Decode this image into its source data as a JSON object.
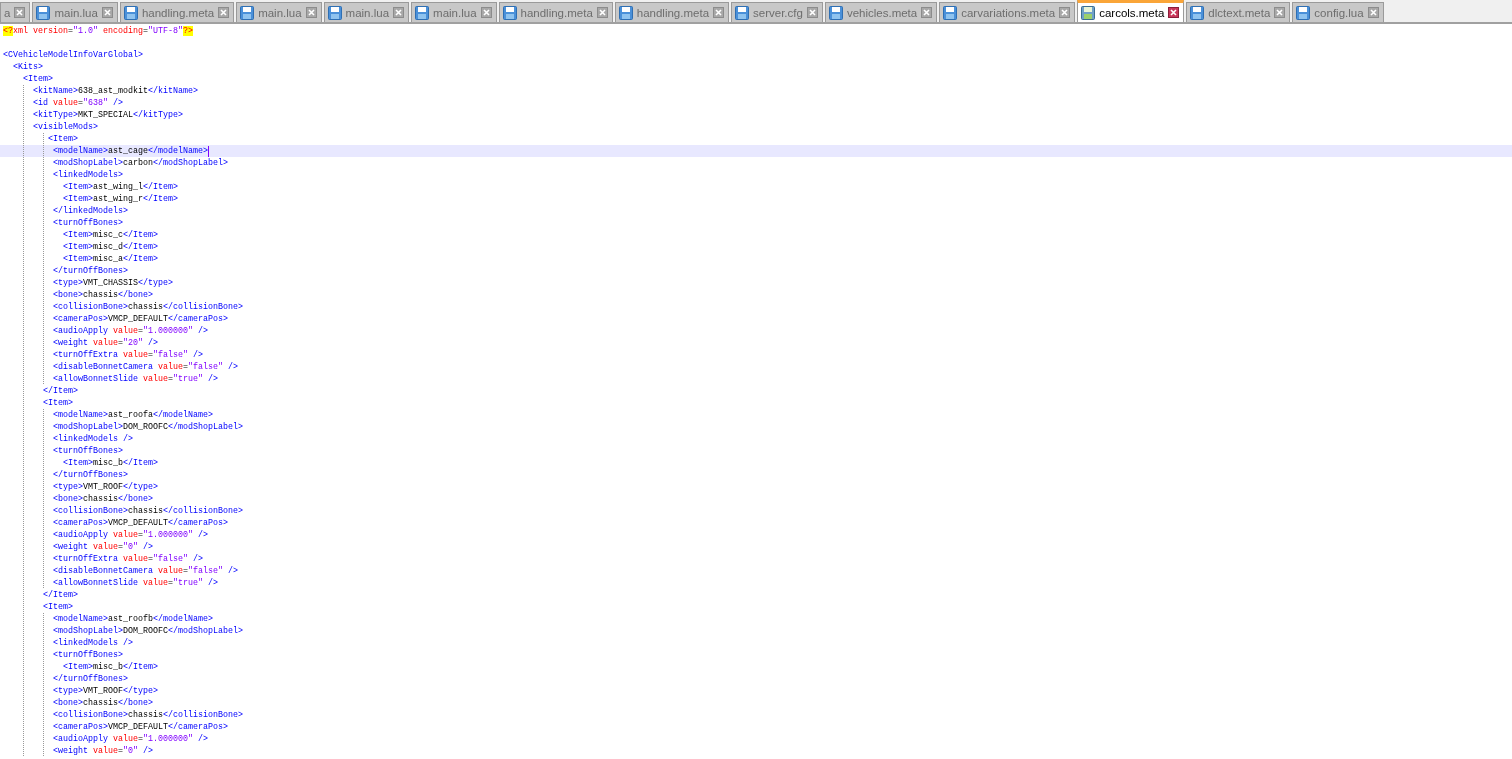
{
  "tabs": [
    {
      "label": "a",
      "selected": false
    },
    {
      "label": "main.lua",
      "selected": false
    },
    {
      "label": "handling.meta",
      "selected": false
    },
    {
      "label": "main.lua",
      "selected": false
    },
    {
      "label": "main.lua",
      "selected": false
    },
    {
      "label": "main.lua",
      "selected": false
    },
    {
      "label": "handling.meta",
      "selected": false
    },
    {
      "label": "handling.meta",
      "selected": false
    },
    {
      "label": "server.cfg",
      "selected": false
    },
    {
      "label": "vehicles.meta",
      "selected": false
    },
    {
      "label": "carvariations.meta",
      "selected": false
    },
    {
      "label": "carcols.meta",
      "selected": true
    },
    {
      "label": "dlctext.meta",
      "selected": false
    },
    {
      "label": "config.lua",
      "selected": false
    }
  ],
  "editor": {
    "lines": [
      {
        "kind": "code",
        "text": "<?xml version=\"1.0\" encoding=\"UTF-8\"?>",
        "current": false
      },
      {
        "kind": "blank",
        "current": false
      },
      {
        "kind": "code",
        "text": "<CVehicleModelInfoVarGlobal>",
        "current": false
      },
      {
        "kind": "code",
        "text": "  <Kits>",
        "current": false
      },
      {
        "kind": "code",
        "text": "    <Item>",
        "current": false
      },
      {
        "kind": "code",
        "text": "      <kitName>638_ast_modkit</kitName>",
        "current": false
      },
      {
        "kind": "code",
        "text": "      <id value=\"638\" />",
        "current": false
      },
      {
        "kind": "code",
        "text": "      <kitType>MKT_SPECIAL</kitType>",
        "current": false
      },
      {
        "kind": "code",
        "text": "      <visibleMods>",
        "current": false
      },
      {
        "kind": "code",
        "text": "         <Item>",
        "current": false
      },
      {
        "kind": "code",
        "text": "          <modelName>ast_cage</modelName>",
        "current": true
      },
      {
        "kind": "code",
        "text": "          <modShopLabel>carbon</modShopLabel>",
        "current": false
      },
      {
        "kind": "code",
        "text": "          <linkedModels>",
        "current": false
      },
      {
        "kind": "code",
        "text": "            <Item>ast_wing_l</Item>",
        "current": false
      },
      {
        "kind": "code",
        "text": "            <Item>ast_wing_r</Item>",
        "current": false
      },
      {
        "kind": "code",
        "text": "          </linkedModels>",
        "current": false
      },
      {
        "kind": "code",
        "text": "          <turnOffBones>",
        "current": false
      },
      {
        "kind": "code",
        "text": "            <Item>misc_c</Item>",
        "current": false
      },
      {
        "kind": "code",
        "text": "            <Item>misc_d</Item>",
        "current": false
      },
      {
        "kind": "code",
        "text": "            <Item>misc_a</Item>",
        "current": false
      },
      {
        "kind": "code",
        "text": "          </turnOffBones>",
        "current": false
      },
      {
        "kind": "code",
        "text": "          <type>VMT_CHASSIS</type>",
        "current": false
      },
      {
        "kind": "code",
        "text": "          <bone>chassis</bone>",
        "current": false
      },
      {
        "kind": "code",
        "text": "          <collisionBone>chassis</collisionBone>",
        "current": false
      },
      {
        "kind": "code",
        "text": "          <cameraPos>VMCP_DEFAULT</cameraPos>",
        "current": false
      },
      {
        "kind": "code",
        "text": "          <audioApply value=\"1.000000\" />",
        "current": false
      },
      {
        "kind": "code",
        "text": "          <weight value=\"20\" />",
        "current": false
      },
      {
        "kind": "code",
        "text": "          <turnOffExtra value=\"false\" />",
        "current": false
      },
      {
        "kind": "code",
        "text": "          <disableBonnetCamera value=\"false\" />",
        "current": false
      },
      {
        "kind": "code",
        "text": "          <allowBonnetSlide value=\"true\" />",
        "current": false
      },
      {
        "kind": "code",
        "text": "        </Item>",
        "current": false
      },
      {
        "kind": "code",
        "text": "        <Item>",
        "current": false
      },
      {
        "kind": "code",
        "text": "          <modelName>ast_roofa</modelName>",
        "current": false
      },
      {
        "kind": "code",
        "text": "          <modShopLabel>DOM_ROOFC</modShopLabel>",
        "current": false
      },
      {
        "kind": "code",
        "text": "          <linkedModels />",
        "current": false
      },
      {
        "kind": "code",
        "text": "          <turnOffBones>",
        "current": false
      },
      {
        "kind": "code",
        "text": "            <Item>misc_b</Item>",
        "current": false
      },
      {
        "kind": "code",
        "text": "          </turnOffBones>",
        "current": false
      },
      {
        "kind": "code",
        "text": "          <type>VMT_ROOF</type>",
        "current": false
      },
      {
        "kind": "code",
        "text": "          <bone>chassis</bone>",
        "current": false
      },
      {
        "kind": "code",
        "text": "          <collisionBone>chassis</collisionBone>",
        "current": false
      },
      {
        "kind": "code",
        "text": "          <cameraPos>VMCP_DEFAULT</cameraPos>",
        "current": false
      },
      {
        "kind": "code",
        "text": "          <audioApply value=\"1.000000\" />",
        "current": false
      },
      {
        "kind": "code",
        "text": "          <weight value=\"0\" />",
        "current": false
      },
      {
        "kind": "code",
        "text": "          <turnOffExtra value=\"false\" />",
        "current": false
      },
      {
        "kind": "code",
        "text": "          <disableBonnetCamera value=\"false\" />",
        "current": false
      },
      {
        "kind": "code",
        "text": "          <allowBonnetSlide value=\"true\" />",
        "current": false
      },
      {
        "kind": "code",
        "text": "        </Item>",
        "current": false
      },
      {
        "kind": "code",
        "text": "        <Item>",
        "current": false
      },
      {
        "kind": "code",
        "text": "          <modelName>ast_roofb</modelName>",
        "current": false
      },
      {
        "kind": "code",
        "text": "          <modShopLabel>DOM_ROOFC</modShopLabel>",
        "current": false
      },
      {
        "kind": "code",
        "text": "          <linkedModels />",
        "current": false
      },
      {
        "kind": "code",
        "text": "          <turnOffBones>",
        "current": false
      },
      {
        "kind": "code",
        "text": "            <Item>misc_b</Item>",
        "current": false
      },
      {
        "kind": "code",
        "text": "          </turnOffBones>",
        "current": false
      },
      {
        "kind": "code",
        "text": "          <type>VMT_ROOF</type>",
        "current": false
      },
      {
        "kind": "code",
        "text": "          <bone>chassis</bone>",
        "current": false
      },
      {
        "kind": "code",
        "text": "          <collisionBone>chassis</collisionBone>",
        "current": false
      },
      {
        "kind": "code",
        "text": "          <cameraPos>VMCP_DEFAULT</cameraPos>",
        "current": false
      },
      {
        "kind": "code",
        "text": "          <audioApply value=\"1.000000\" />",
        "current": false
      },
      {
        "kind": "code",
        "text": "          <weight value=\"0\" />",
        "current": false
      }
    ]
  }
}
